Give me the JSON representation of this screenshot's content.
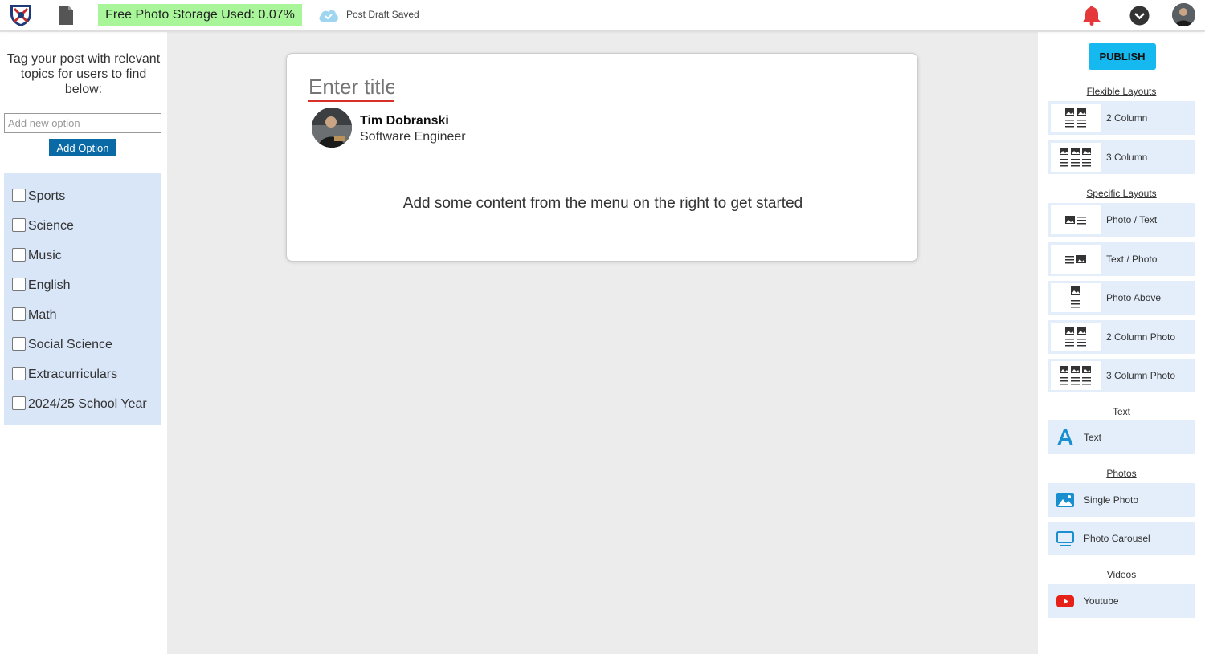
{
  "topbar": {
    "storage_label": "Free Photo Storage Used: 0.07%",
    "draft_status": "Post Draft Saved",
    "icons": [
      "shield-logo",
      "document-icon",
      "cloud-check-icon",
      "bell-icon",
      "chevron-down-icon",
      "user-avatar"
    ]
  },
  "left": {
    "prompt": "Tag your post with relevant topics for users to find below:",
    "new_option_placeholder": "Add new option",
    "add_option_label": "Add Option",
    "topics": [
      "Sports",
      "Science",
      "Music",
      "English",
      "Math",
      "Social Science",
      "Extracurriculars",
      "2024/25 School Year"
    ]
  },
  "editor": {
    "title_placeholder": "Enter title",
    "author_name": "Tim Dobranski",
    "author_role": "Software Engineer",
    "empty_message": "Add some content from the menu on the right to get started"
  },
  "right": {
    "publish_label": "PUBLISH",
    "flexible_heading": "Flexible Layouts",
    "flexible": [
      "2 Column",
      "3 Column"
    ],
    "specific_heading": "Specific Layouts",
    "specific": [
      "Photo / Text",
      "Text / Photo",
      "Photo Above",
      "2 Column Photo",
      "3 Column Photo"
    ],
    "text_heading": "Text",
    "text_items": [
      "Text"
    ],
    "photos_heading": "Photos",
    "photos_items": [
      "Single Photo",
      "Photo Carousel"
    ],
    "videos_heading": "Videos",
    "videos_items": [
      "Youtube"
    ]
  },
  "colors": {
    "accent_blue": "#1c7fc2",
    "publish_bg": "#16b8f0",
    "storage_bg": "#a8f59a",
    "bell_red": "#e5383b",
    "youtube_red": "#e62117",
    "topic_panel": "#d9e6f8"
  }
}
